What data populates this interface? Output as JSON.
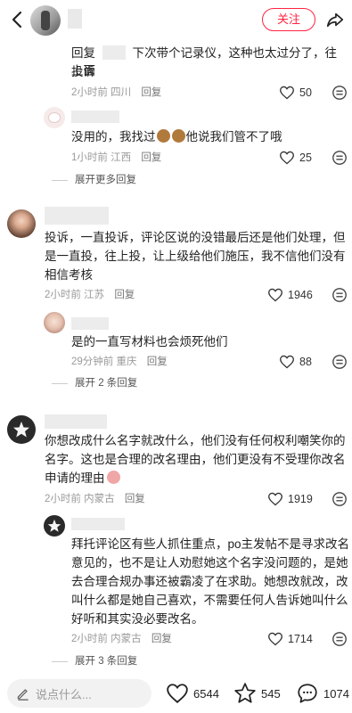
{
  "header": {
    "follow_label": "关注"
  },
  "comments": [
    {
      "text": "回复 下次带个记录仪，这种也太过分了，往上面投诉",
      "text_prefix": "回复",
      "text_rest": "下次带个记录仪，这种也太过分了，往上面",
      "text_line2": "投诉",
      "time": "2小时前",
      "location": "四川",
      "reply": "回复",
      "likes": "50"
    },
    {
      "text_a": "没用的，我找过",
      "text_b": "他说我们管不了哦",
      "time": "1小时前",
      "location": "江西",
      "reply": "回复",
      "likes": "25"
    },
    {
      "line1": "投诉，一直投诉，评论区说的没错最后还是他们处理，但",
      "line2": "是一直投，往上投，让上级给他们施压，我不信他们没有",
      "line3": "相信考核",
      "time": "2小时前",
      "location": "江苏",
      "reply": "回复",
      "likes": "1946"
    },
    {
      "text": "是的一直写材料也会烦死他们",
      "time": "29分钟前",
      "location": "重庆",
      "reply": "回复",
      "likes": "88"
    },
    {
      "line1": "你想改成什么名字就改什么，他们没有任何权利嘲笑你的",
      "line2": "名字。这也是合理的改名理由，他们更没有不受理你改名",
      "line3": "申请的理由",
      "time": "2小时前",
      "location": "内蒙古",
      "reply": "回复",
      "likes": "1919"
    },
    {
      "line1": "拜托评论区有些人抓住重点，po主发帖不是寻求改名",
      "line2": "意见的，也不是让人劝慰她这个名字没问题的，是她",
      "line3": "去合理合规办事还被霸凌了在求助。她想改就改，改",
      "line4": "叫什么都是她自己喜欢，不需要任何人告诉她叫什么",
      "line5": "好听和其实没必要改名。",
      "time": "2小时前",
      "location": "内蒙古",
      "reply": "回复",
      "likes": "1714"
    }
  ],
  "expand": {
    "first": "展开更多回复",
    "second": "展开 2 条回复",
    "third": "展开 3 条回复"
  },
  "bottom": {
    "input_placeholder": "说点什么...",
    "likes": "6544",
    "stars": "545",
    "comments": "1074"
  },
  "colors": {
    "accent": "#ff2442",
    "meta": "#9a9a9a"
  }
}
